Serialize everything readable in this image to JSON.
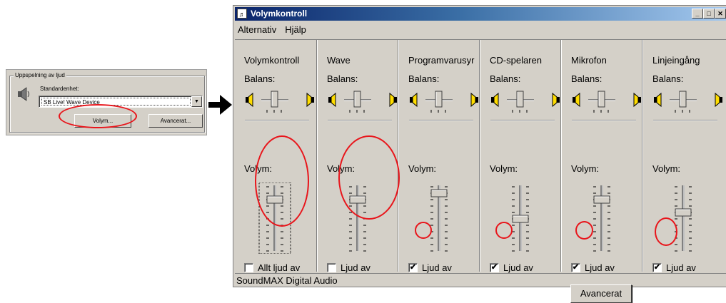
{
  "snippet": {
    "group_title": "Uppspelning av ljud",
    "standard_label": "Standardenhet:",
    "device_value": "SB Live! Wave Device",
    "volume_button": "Volym...",
    "advanced_button": "Avancerat..."
  },
  "window": {
    "title": "Volymkontroll",
    "menu": [
      "Alternativ",
      "Hjälp"
    ],
    "status": "SoundMAX Digital Audio"
  },
  "columns": [
    {
      "title": "Volymkontroll",
      "balance_label": "Balans:",
      "volume_label": "Volym:",
      "mute_label": "Allt ljud av",
      "muted": false,
      "volume": 0.8
    },
    {
      "title": "Wave",
      "balance_label": "Balans:",
      "volume_label": "Volym:",
      "mute_label": "Ljud av",
      "muted": false,
      "volume": 0.8
    },
    {
      "title": "Programvarusyr",
      "balance_label": "Balans:",
      "volume_label": "Volym:",
      "mute_label": "Ljud av",
      "muted": true,
      "volume": 0.9
    },
    {
      "title": "CD-spelaren",
      "balance_label": "Balans:",
      "volume_label": "Volym:",
      "mute_label": "Ljud av",
      "muted": true,
      "volume": 0.5
    },
    {
      "title": "Mikrofon",
      "balance_label": "Balans:",
      "volume_label": "Volym:",
      "mute_label": "Ljud av",
      "muted": true,
      "volume": 0.8,
      "advanced": "Avancerat"
    },
    {
      "title": "Linjeingång",
      "balance_label": "Balans:",
      "volume_label": "Volym:",
      "mute_label": "Ljud av",
      "muted": true,
      "volume": 0.6
    }
  ],
  "colors": {
    "highlight": "#e8151b",
    "title_start": "#0a246a",
    "face": "#d4d0c8"
  }
}
